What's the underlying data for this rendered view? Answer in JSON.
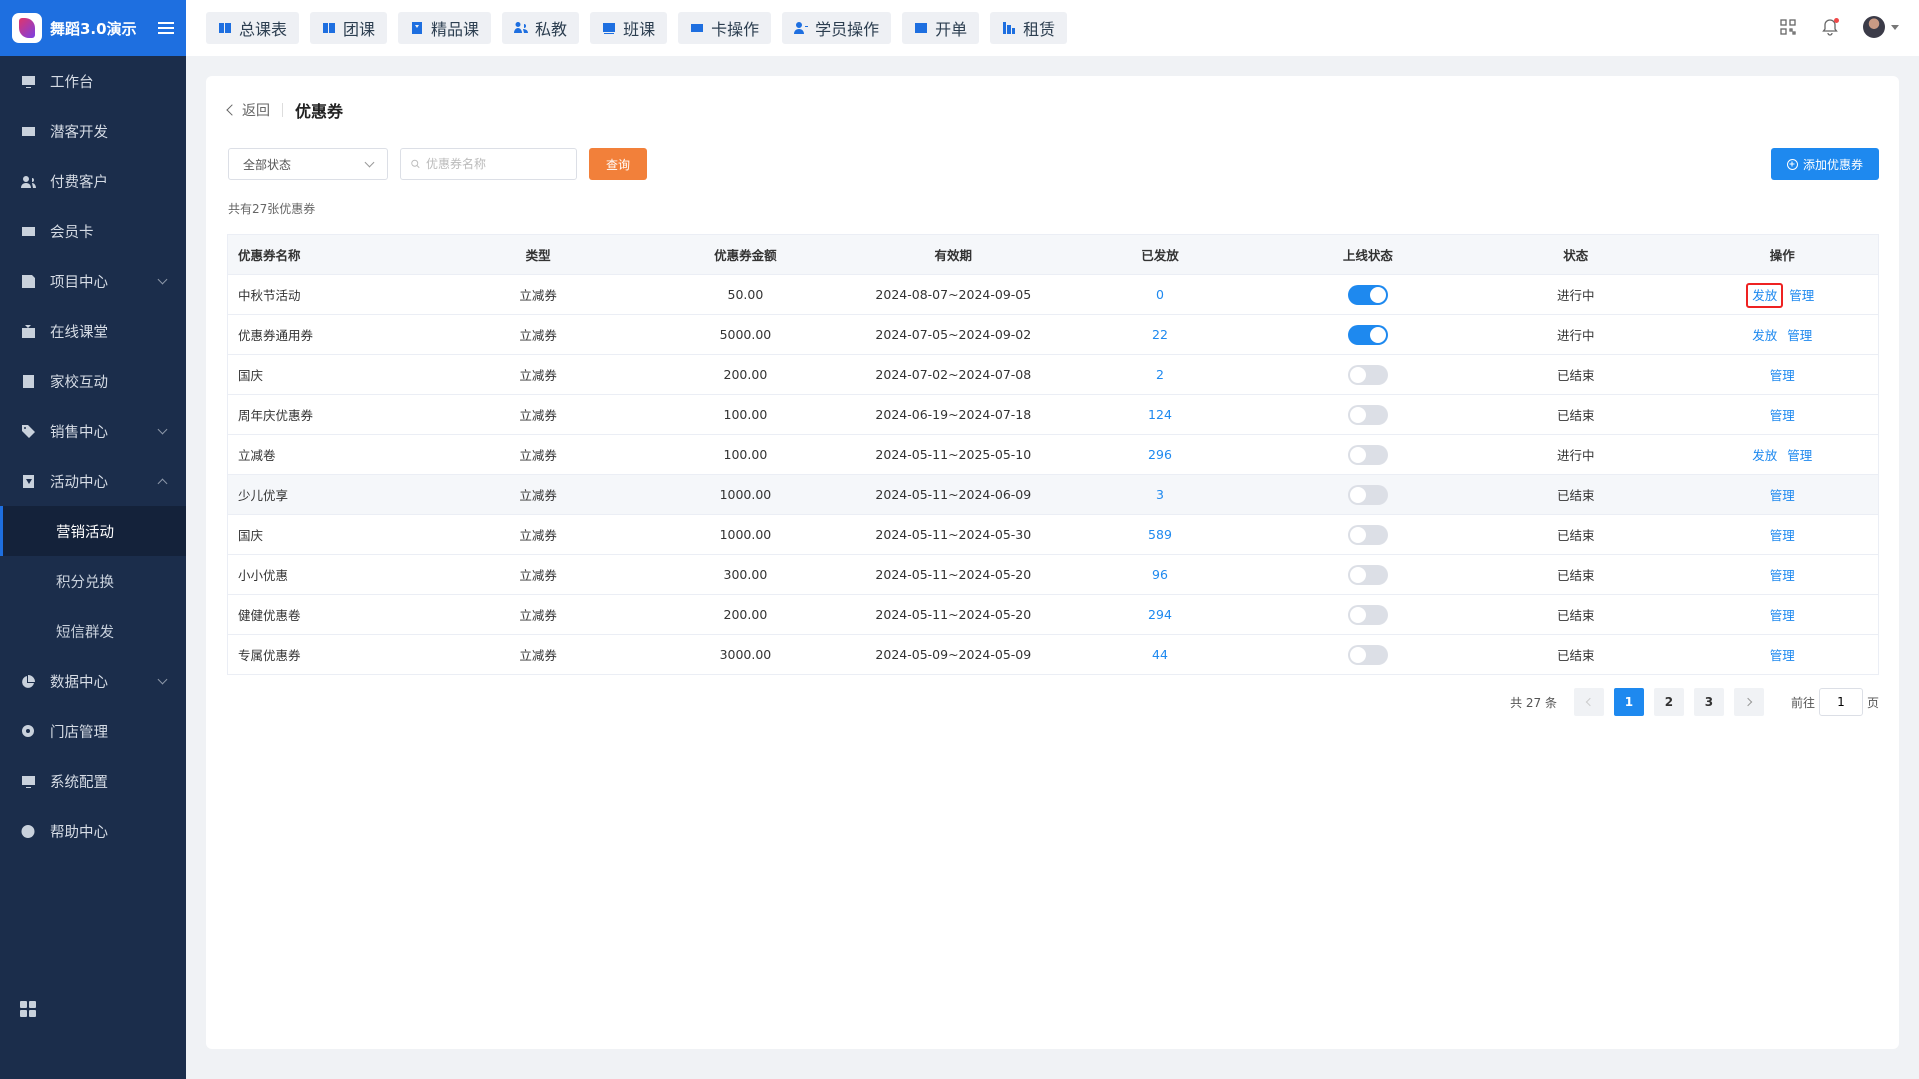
{
  "app": {
    "title": "舞蹈3.0演示"
  },
  "sidebar": {
    "items": [
      {
        "label": "工作台",
        "icon": "monitor-icon"
      },
      {
        "label": "潜客开发",
        "icon": "id-card-icon"
      },
      {
        "label": "付费客户",
        "icon": "users-icon"
      },
      {
        "label": "会员卡",
        "icon": "card-icon"
      },
      {
        "label": "项目中心",
        "icon": "list-icon",
        "expandable": true
      },
      {
        "label": "在线课堂",
        "icon": "tv-icon"
      },
      {
        "label": "家校互动",
        "icon": "contacts-icon"
      },
      {
        "label": "销售中心",
        "icon": "tag-icon",
        "expandable": true
      },
      {
        "label": "活动中心",
        "icon": "activity-icon",
        "expanded": true
      }
    ],
    "sub_items": [
      "营销活动",
      "积分兑换",
      "短信群发"
    ],
    "items_after": [
      {
        "label": "数据中心",
        "icon": "pie-chart-icon",
        "expandable": true
      },
      {
        "label": "门店管理",
        "icon": "store-icon"
      },
      {
        "label": "系统配置",
        "icon": "settings-icon"
      },
      {
        "label": "帮助中心",
        "icon": "help-icon"
      }
    ]
  },
  "header": {
    "tabs": [
      "总课表",
      "团课",
      "精品课",
      "私教",
      "班课",
      "卡操作",
      "学员操作",
      "开单",
      "租赁"
    ]
  },
  "page": {
    "back_label": "返回",
    "title": "优惠券",
    "status_select": "全部状态",
    "search_placeholder": "优惠券名称",
    "query_label": "查询",
    "add_label": "添加优惠券",
    "count_text": "共有27张优惠券"
  },
  "table": {
    "headers": [
      "优惠券名称",
      "类型",
      "优惠券金额",
      "有效期",
      "已发放",
      "上线状态",
      "状态",
      "操作"
    ],
    "rows": [
      {
        "name": "中秋节活动",
        "type": "立减券",
        "amount": "50.00",
        "validity": "2024-08-07~2024-09-05",
        "issued": "0",
        "online": true,
        "status": "进行中",
        "ops": [
          "发放",
          "管理"
        ]
      },
      {
        "name": "优惠券通用券",
        "type": "立减券",
        "amount": "5000.00",
        "validity": "2024-07-05~2024-09-02",
        "issued": "22",
        "online": true,
        "status": "进行中",
        "ops": [
          "发放",
          "管理"
        ]
      },
      {
        "name": "国庆",
        "type": "立减券",
        "amount": "200.00",
        "validity": "2024-07-02~2024-07-08",
        "issued": "2",
        "online": false,
        "status": "已结束",
        "ops": [
          "管理"
        ]
      },
      {
        "name": "周年庆优惠券",
        "type": "立减券",
        "amount": "100.00",
        "validity": "2024-06-19~2024-07-18",
        "issued": "124",
        "online": false,
        "status": "已结束",
        "ops": [
          "管理"
        ]
      },
      {
        "name": "立减卷",
        "type": "立减券",
        "amount": "100.00",
        "validity": "2024-05-11~2025-05-10",
        "issued": "296",
        "online": false,
        "status": "进行中",
        "ops": [
          "发放",
          "管理"
        ]
      },
      {
        "name": "少儿优享",
        "type": "立减券",
        "amount": "1000.00",
        "validity": "2024-05-11~2024-06-09",
        "issued": "3",
        "online": false,
        "status": "已结束",
        "ops": [
          "管理"
        ]
      },
      {
        "name": "国庆",
        "type": "立减券",
        "amount": "1000.00",
        "validity": "2024-05-11~2024-05-30",
        "issued": "589",
        "online": false,
        "status": "已结束",
        "ops": [
          "管理"
        ]
      },
      {
        "name": "小小优惠",
        "type": "立减券",
        "amount": "300.00",
        "validity": "2024-05-11~2024-05-20",
        "issued": "96",
        "online": false,
        "status": "已结束",
        "ops": [
          "管理"
        ]
      },
      {
        "name": "健健优惠卷",
        "type": "立减券",
        "amount": "200.00",
        "validity": "2024-05-11~2024-05-20",
        "issued": "294",
        "online": false,
        "status": "已结束",
        "ops": [
          "管理"
        ]
      },
      {
        "name": "专属优惠券",
        "type": "立减券",
        "amount": "3000.00",
        "validity": "2024-05-09~2024-05-09",
        "issued": "44",
        "online": false,
        "status": "已结束",
        "ops": [
          "管理"
        ]
      }
    ]
  },
  "pagination": {
    "total_text": "共 27 条",
    "pages": [
      "1",
      "2",
      "3"
    ],
    "current": "1",
    "goto_prefix": "前往",
    "goto_value": "1",
    "goto_suffix": "页"
  },
  "colors": {
    "primary": "#1e89ef",
    "sidebar": "#1b2d4b",
    "query": "#f2803a",
    "highlight_box": "#ee2222"
  }
}
